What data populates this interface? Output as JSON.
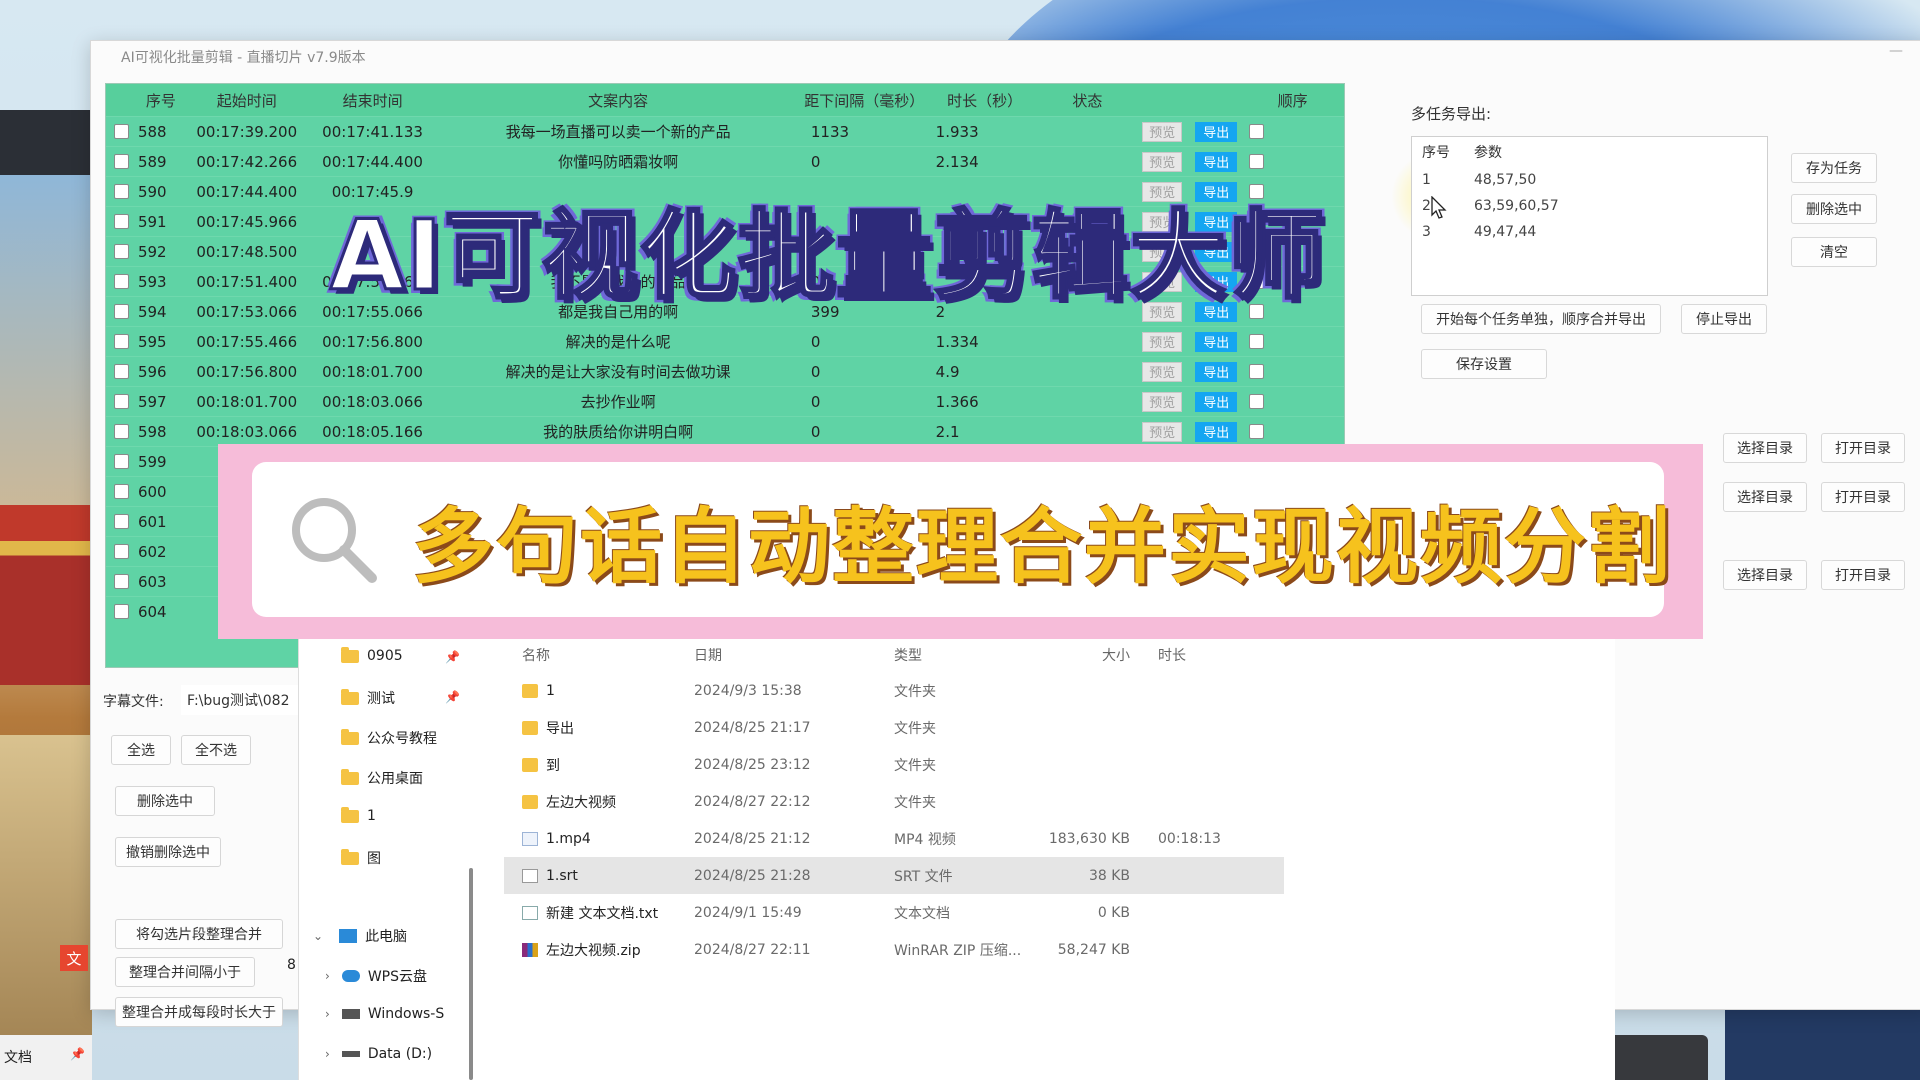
{
  "window": {
    "title": "AI可视化批量剪辑 - 直播切片 v7.9版本",
    "minimize": "—"
  },
  "table": {
    "headers": [
      "序号",
      "起始时间",
      "结束时间",
      "文案内容",
      "距下间隔（毫秒）",
      "时长（秒）",
      "状态",
      "",
      "",
      "顺序"
    ],
    "preview_label": "预览",
    "export_label": "导出",
    "rows": [
      {
        "idx": "588",
        "start": "00:17:39.200",
        "end": "00:17:41.133",
        "text": "我每一场直播可以卖一个新的产品",
        "gap": "1133",
        "dur": "1.933"
      },
      {
        "idx": "589",
        "start": "00:17:42.266",
        "end": "00:17:44.400",
        "text": "你懂吗防晒霜妆啊",
        "gap": "0",
        "dur": "2.134"
      },
      {
        "idx": "590",
        "start": "00:17:44.400",
        "end": "00:17:45.9",
        "text": "",
        "gap": "",
        "dur": ""
      },
      {
        "idx": "591",
        "start": "00:17:45.966",
        "end": "",
        "text": "",
        "gap": "",
        "dur": ""
      },
      {
        "idx": "592",
        "start": "00:17:48.500",
        "end": "",
        "text": "",
        "gap": "",
        "dur": ""
      },
      {
        "idx": "593",
        "start": "00:17:51.400",
        "end": "00:17:53.066",
        "text": "我不是卖我们的产品",
        "gap": "0",
        "dur": ""
      },
      {
        "idx": "594",
        "start": "00:17:53.066",
        "end": "00:17:55.066",
        "text": "都是我自己用的啊",
        "gap": "399",
        "dur": "2"
      },
      {
        "idx": "595",
        "start": "00:17:55.466",
        "end": "00:17:56.800",
        "text": "解决的是什么呢",
        "gap": "0",
        "dur": "1.334"
      },
      {
        "idx": "596",
        "start": "00:17:56.800",
        "end": "00:18:01.700",
        "text": "解决的是让大家没有时间去做功课",
        "gap": "0",
        "dur": "4.9"
      },
      {
        "idx": "597",
        "start": "00:18:01.700",
        "end": "00:18:03.066",
        "text": "去抄作业啊",
        "gap": "0",
        "dur": "1.366"
      },
      {
        "idx": "598",
        "start": "00:18:03.066",
        "end": "00:18:05.166",
        "text": "我的肤质给你讲明白啊",
        "gap": "0",
        "dur": "2.1"
      },
      {
        "idx": "599",
        "start": "",
        "end": "",
        "text": "",
        "gap": "",
        "dur": ""
      },
      {
        "idx": "600",
        "start": "",
        "end": "",
        "text": "",
        "gap": "",
        "dur": ""
      },
      {
        "idx": "601",
        "start": "",
        "end": "",
        "text": "",
        "gap": "",
        "dur": ""
      },
      {
        "idx": "602",
        "start": "",
        "end": "",
        "text": "",
        "gap": "",
        "dur": ""
      },
      {
        "idx": "603",
        "start": "",
        "end": "",
        "text": "",
        "gap": "",
        "dur": ""
      },
      {
        "idx": "604",
        "start": "",
        "end": "",
        "text": "",
        "gap": "",
        "dur": ""
      }
    ]
  },
  "left_panel": {
    "subtitle_file_label": "字幕文件:",
    "subtitle_file_path": "F:\\bug测试\\082",
    "select_all": "全选",
    "select_none": "全不选",
    "delete_selected": "删除选中",
    "undo_delete": "撤销删除选中",
    "merge_selected": "将勾选片段整理合并",
    "merge_gap_less": "整理合并间隔小于",
    "merge_gap_value": "8",
    "merge_duration_more": "整理合并成每段时长大于",
    "wen": "文"
  },
  "right_panel": {
    "multi_task_label": "多任务导出:",
    "task_headers": [
      "序号",
      "参数"
    ],
    "tasks": [
      {
        "idx": "1",
        "param": "48,57,50"
      },
      {
        "idx": "2",
        "param": "63,59,60,57"
      },
      {
        "idx": "3",
        "param": "49,47,44"
      }
    ],
    "save_task": "存为任务",
    "delete_selected": "删除选中",
    "clear": "清空",
    "start_export": "开始每个任务单独，顺序合并导出",
    "stop_export": "停止导出",
    "save_settings": "保存设置",
    "choose_dir": "选择目录",
    "open_dir": "打开目录"
  },
  "overlay": {
    "headline": "AI可视化批量剪辑大师",
    "banner": "多句话自动整理合并实现视频分割"
  },
  "explorer": {
    "nav": [
      {
        "label": "0905",
        "pinned": true
      },
      {
        "label": "测试",
        "pinned": true
      },
      {
        "label": "公众号教程",
        "pinned": false
      },
      {
        "label": "公用桌面",
        "pinned": false
      },
      {
        "label": "1",
        "pinned": false
      },
      {
        "label": "图",
        "pinned": false
      }
    ],
    "this_pc": "此电脑",
    "wps_cloud": "WPS云盘",
    "windows_drive": "Windows-S",
    "data_drive": "Data (D:)",
    "quick_doc": "文档",
    "columns": {
      "name": "名称",
      "date": "日期",
      "type": "类型",
      "size": "大小",
      "duration": "时长"
    },
    "files": [
      {
        "name": "1",
        "date": "2024/9/3 15:38",
        "type": "文件夹",
        "size": "",
        "duration": "",
        "icon": "folder-icon"
      },
      {
        "name": "导出",
        "date": "2024/8/25 21:17",
        "type": "文件夹",
        "size": "",
        "duration": "",
        "icon": "folder-icon"
      },
      {
        "name": "到",
        "date": "2024/8/25 23:12",
        "type": "文件夹",
        "size": "",
        "duration": "",
        "icon": "folder-icon"
      },
      {
        "name": "左边大视频",
        "date": "2024/8/27 22:12",
        "type": "文件夹",
        "size": "",
        "duration": "",
        "icon": "folder-icon"
      },
      {
        "name": "1.mp4",
        "date": "2024/8/25 21:12",
        "type": "MP4 视频",
        "size": "183,630 KB",
        "duration": "00:18:13",
        "icon": "video-file-icon"
      },
      {
        "name": "1.srt",
        "date": "2024/8/25 21:28",
        "type": "SRT 文件",
        "size": "38 KB",
        "duration": "",
        "icon": "srt-file-icon"
      },
      {
        "name": "新建 文本文档.txt",
        "date": "2024/9/1 15:49",
        "type": "文本文档",
        "size": "0 KB",
        "duration": "",
        "icon": "text-file-icon"
      },
      {
        "name": "左边大视频.zip",
        "date": "2024/8/27 22:11",
        "type": "WinRAR ZIP 压缩...",
        "size": "58,247 KB",
        "duration": "",
        "icon": "zip-file-icon"
      }
    ]
  }
}
